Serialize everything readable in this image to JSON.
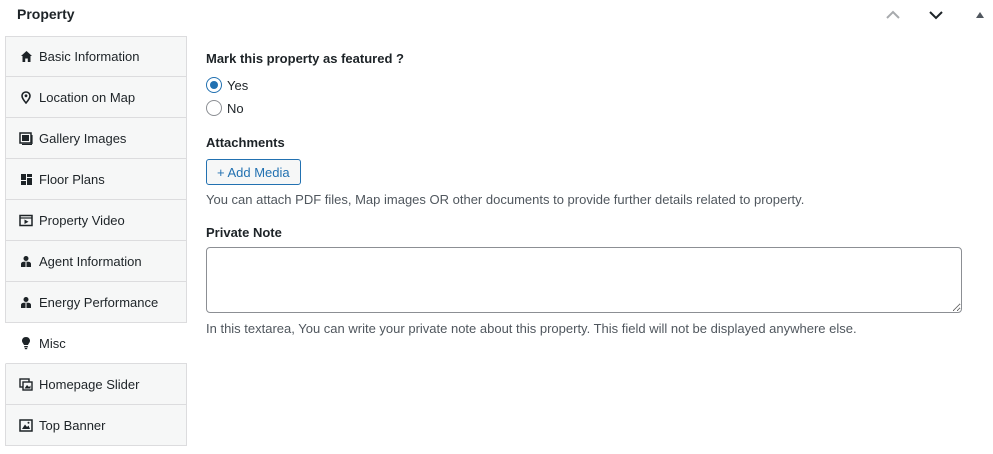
{
  "header": {
    "title": "Property",
    "move_up_icon": "chevron-up-icon",
    "move_down_icon": "chevron-down-icon",
    "toggle_icon": "triangle-up-icon"
  },
  "tabs": [
    {
      "label": "Basic Information",
      "icon": "home-icon",
      "active": false
    },
    {
      "label": "Location on Map",
      "icon": "location-pin-icon",
      "active": false
    },
    {
      "label": "Gallery Images",
      "icon": "gallery-icon",
      "active": false
    },
    {
      "label": "Floor Plans",
      "icon": "floor-plan-icon",
      "active": false
    },
    {
      "label": "Property Video",
      "icon": "video-icon",
      "active": false
    },
    {
      "label": "Agent Information",
      "icon": "agent-icon",
      "active": false
    },
    {
      "label": "Energy Performance",
      "icon": "energy-icon",
      "active": false
    },
    {
      "label": "Misc",
      "icon": "lightbulb-icon",
      "active": true
    },
    {
      "label": "Homepage Slider",
      "icon": "slider-icon",
      "active": false
    },
    {
      "label": "Top Banner",
      "icon": "banner-image-icon",
      "active": false
    }
  ],
  "featured": {
    "label": "Mark this property as featured ?",
    "options": [
      {
        "label": "Yes",
        "checked": true
      },
      {
        "label": "No",
        "checked": false
      }
    ]
  },
  "attachments": {
    "label": "Attachments",
    "button_label": "+ Add Media",
    "help": "You can attach PDF files, Map images OR other documents to provide further details related to property."
  },
  "private_note": {
    "label": "Private Note",
    "value": "",
    "help": "In this textarea, You can write your private note about this property. This field will not be displayed anywhere else."
  },
  "colors": {
    "accent": "#2271b1",
    "tab_bg": "#f6f7f7",
    "border": "#dcdcde"
  }
}
